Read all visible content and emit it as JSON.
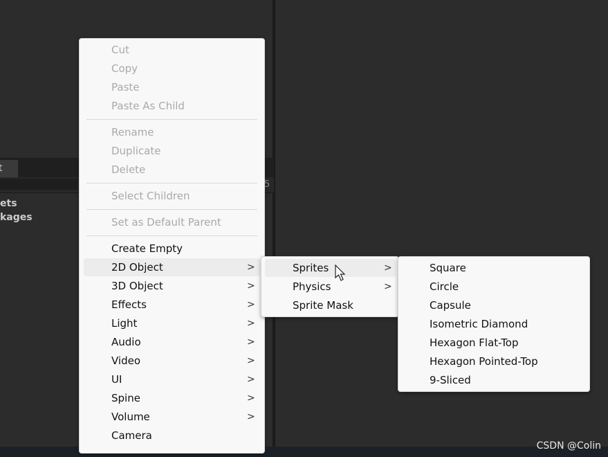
{
  "background": {
    "tab_label": "t",
    "counter": "5",
    "project_items": [
      "ets",
      "kages"
    ]
  },
  "context_menu": {
    "group1": [
      "Cut",
      "Copy",
      "Paste",
      "Paste As Child"
    ],
    "group2": [
      "Rename",
      "Duplicate",
      "Delete"
    ],
    "group3": [
      "Select Children"
    ],
    "group4": [
      "Set as Default Parent"
    ],
    "create_empty": "Create Empty",
    "submenus": [
      "2D Object",
      "3D Object",
      "Effects",
      "Light",
      "Audio",
      "Video",
      "UI",
      "Spine",
      "Volume"
    ],
    "camera": "Camera"
  },
  "submenu_2d": {
    "items": [
      {
        "label": "Sprites",
        "has_sub": true
      },
      {
        "label": "Physics",
        "has_sub": true
      },
      {
        "label": "Sprite Mask",
        "has_sub": false
      }
    ]
  },
  "submenu_sprites": {
    "items": [
      "Square",
      "Circle",
      "Capsule",
      "Isometric Diamond",
      "Hexagon Flat-Top",
      "Hexagon Pointed-Top",
      "9-Sliced"
    ]
  },
  "chevron": ">",
  "watermark": "CSDN @Colin"
}
